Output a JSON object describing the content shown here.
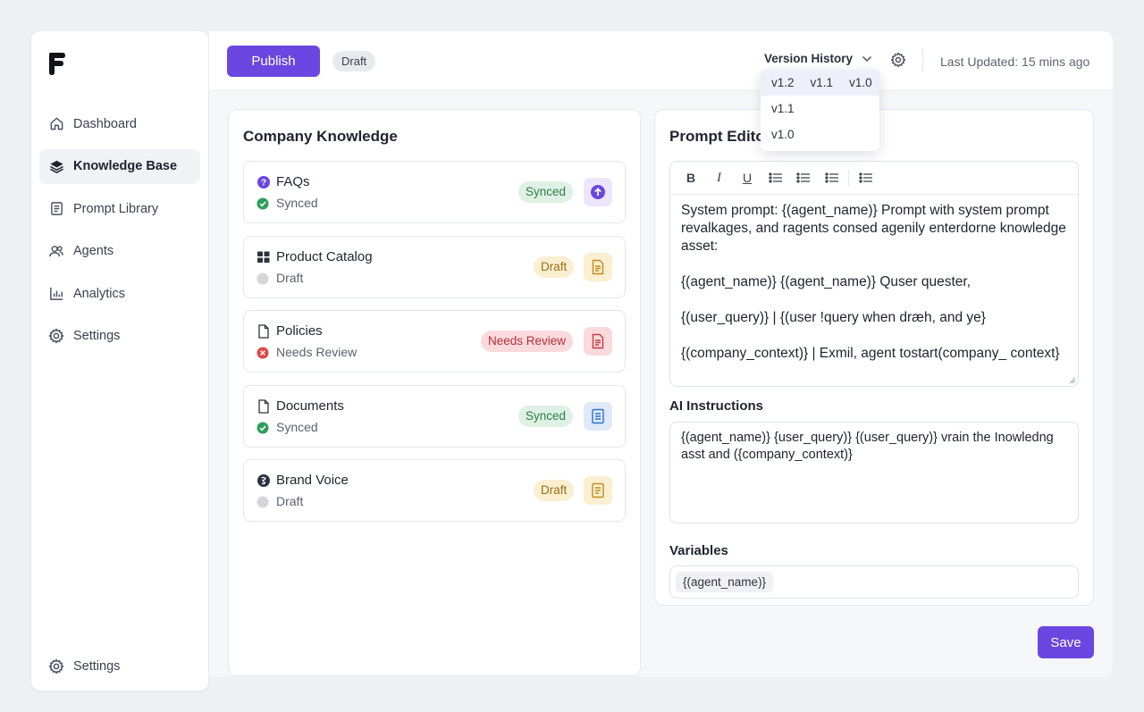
{
  "sidebar": {
    "items": [
      {
        "label": "Dashboard",
        "icon": "home-icon"
      },
      {
        "label": "Knowledge Base",
        "icon": "layers-icon"
      },
      {
        "label": "Prompt Library",
        "icon": "document-icon"
      },
      {
        "label": "Agents",
        "icon": "users-icon"
      },
      {
        "label": "Analytics",
        "icon": "chart-icon"
      },
      {
        "label": "Settings",
        "icon": "gear-icon"
      }
    ],
    "bottom_label": "Settings",
    "active_index": 1
  },
  "topbar": {
    "publish_label": "Publish",
    "status_badge": "Draft",
    "version_history_label": "Version History",
    "last_updated": "Last Updated: 15 mins ago"
  },
  "version_dropdown": {
    "highlighted_row": [
      "v1.2",
      "v1.1",
      "v1.0"
    ],
    "options": [
      "v1.1",
      "v1.0"
    ]
  },
  "knowledge": {
    "title": "Company Knowledge",
    "items": [
      {
        "name": "FAQs",
        "status": "Synced",
        "badge": "Synced",
        "kind": "synced",
        "icon": "question-icon",
        "action_icon": "upload-icon"
      },
      {
        "name": "Product Catalog",
        "status": "Draft",
        "badge": "Draft",
        "kind": "draft",
        "icon": "grid-icon",
        "action_icon": "file-icon"
      },
      {
        "name": "Policies",
        "status": "Needs Review",
        "badge": "Needs Review",
        "kind": "review",
        "icon": "page-icon",
        "action_icon": "file-icon"
      },
      {
        "name": "Documents",
        "status": "Synced",
        "badge": "Synced",
        "kind": "synced",
        "icon": "page-icon",
        "action_icon": "file-icon"
      },
      {
        "name": "Brand Voice",
        "status": "Draft",
        "badge": "Draft",
        "kind": "draft",
        "icon": "globe-icon",
        "action_icon": "file-icon"
      }
    ]
  },
  "prompt_editor": {
    "title": "Prompt Editor",
    "toolbar": [
      "B",
      "I",
      "U"
    ],
    "paragraphs": [
      "System prompt: {(agent_name)} Prompt with system prompt revalkages, and ragents consed agenily enterdorne knowledge asset:",
      "{(agent_name)} {(agent_name)} Quser quester,",
      "{(user_query)} | {(user !query when dræh, and ye}",
      "{(company_context)} | Exmil, agent tostart(company_ context}"
    ],
    "ai_instructions_label": "AI Instructions",
    "ai_instructions_text": "{(agent_name)} {user_query)} {(user_query)} vrain the Inowledng asst and ({company_context)}",
    "variables_label": "Variables",
    "variable_chip": "{(agent_name)}",
    "save_label": "Save"
  },
  "colors": {
    "accent": "#6b46e0",
    "synced": "#2e9d5a",
    "draft": "#d4d4d8",
    "review": "#e04747"
  }
}
